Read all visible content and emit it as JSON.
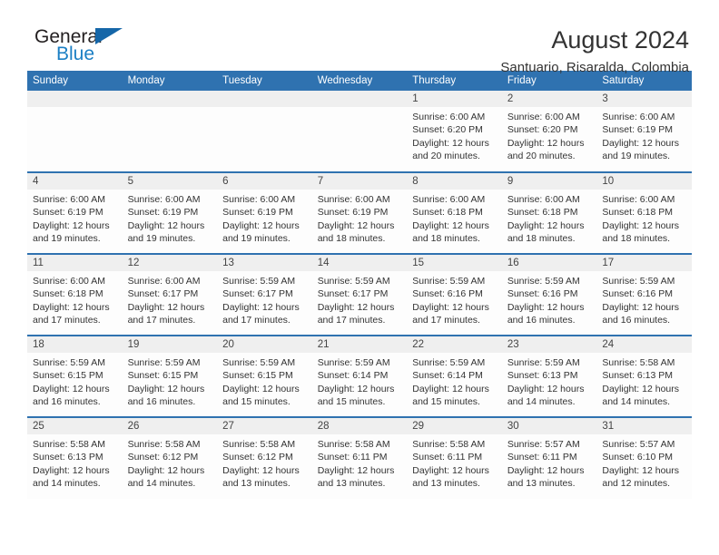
{
  "brand": {
    "name_top": "General",
    "name_bottom": "Blue",
    "mark": "triangle-logo-mark",
    "color_text": "#231f20",
    "color_blue": "#1b7fc4",
    "color_mark": "#1566a8"
  },
  "header": {
    "month_title": "August 2024",
    "location": "Santuario, Risaralda, Colombia"
  },
  "theme": {
    "header_blue": "#2f72b0",
    "daynum_band": "#efefef",
    "text": "#333333"
  },
  "weekday_headers": [
    "Sunday",
    "Monday",
    "Tuesday",
    "Wednesday",
    "Thursday",
    "Friday",
    "Saturday"
  ],
  "weeks": [
    [
      {
        "day": "",
        "empty": true,
        "sunrise": "",
        "sunset": "",
        "daylight_line1": "",
        "daylight_line2": ""
      },
      {
        "day": "",
        "empty": true,
        "sunrise": "",
        "sunset": "",
        "daylight_line1": "",
        "daylight_line2": ""
      },
      {
        "day": "",
        "empty": true,
        "sunrise": "",
        "sunset": "",
        "daylight_line1": "",
        "daylight_line2": ""
      },
      {
        "day": "",
        "empty": true,
        "sunrise": "",
        "sunset": "",
        "daylight_line1": "",
        "daylight_line2": ""
      },
      {
        "day": "1",
        "empty": false,
        "sunrise": "Sunrise: 6:00 AM",
        "sunset": "Sunset: 6:20 PM",
        "daylight_line1": "Daylight: 12 hours",
        "daylight_line2": "and 20 minutes."
      },
      {
        "day": "2",
        "empty": false,
        "sunrise": "Sunrise: 6:00 AM",
        "sunset": "Sunset: 6:20 PM",
        "daylight_line1": "Daylight: 12 hours",
        "daylight_line2": "and 20 minutes."
      },
      {
        "day": "3",
        "empty": false,
        "sunrise": "Sunrise: 6:00 AM",
        "sunset": "Sunset: 6:19 PM",
        "daylight_line1": "Daylight: 12 hours",
        "daylight_line2": "and 19 minutes."
      }
    ],
    [
      {
        "day": "4",
        "empty": false,
        "sunrise": "Sunrise: 6:00 AM",
        "sunset": "Sunset: 6:19 PM",
        "daylight_line1": "Daylight: 12 hours",
        "daylight_line2": "and 19 minutes."
      },
      {
        "day": "5",
        "empty": false,
        "sunrise": "Sunrise: 6:00 AM",
        "sunset": "Sunset: 6:19 PM",
        "daylight_line1": "Daylight: 12 hours",
        "daylight_line2": "and 19 minutes."
      },
      {
        "day": "6",
        "empty": false,
        "sunrise": "Sunrise: 6:00 AM",
        "sunset": "Sunset: 6:19 PM",
        "daylight_line1": "Daylight: 12 hours",
        "daylight_line2": "and 19 minutes."
      },
      {
        "day": "7",
        "empty": false,
        "sunrise": "Sunrise: 6:00 AM",
        "sunset": "Sunset: 6:19 PM",
        "daylight_line1": "Daylight: 12 hours",
        "daylight_line2": "and 18 minutes."
      },
      {
        "day": "8",
        "empty": false,
        "sunrise": "Sunrise: 6:00 AM",
        "sunset": "Sunset: 6:18 PM",
        "daylight_line1": "Daylight: 12 hours",
        "daylight_line2": "and 18 minutes."
      },
      {
        "day": "9",
        "empty": false,
        "sunrise": "Sunrise: 6:00 AM",
        "sunset": "Sunset: 6:18 PM",
        "daylight_line1": "Daylight: 12 hours",
        "daylight_line2": "and 18 minutes."
      },
      {
        "day": "10",
        "empty": false,
        "sunrise": "Sunrise: 6:00 AM",
        "sunset": "Sunset: 6:18 PM",
        "daylight_line1": "Daylight: 12 hours",
        "daylight_line2": "and 18 minutes."
      }
    ],
    [
      {
        "day": "11",
        "empty": false,
        "sunrise": "Sunrise: 6:00 AM",
        "sunset": "Sunset: 6:18 PM",
        "daylight_line1": "Daylight: 12 hours",
        "daylight_line2": "and 17 minutes."
      },
      {
        "day": "12",
        "empty": false,
        "sunrise": "Sunrise: 6:00 AM",
        "sunset": "Sunset: 6:17 PM",
        "daylight_line1": "Daylight: 12 hours",
        "daylight_line2": "and 17 minutes."
      },
      {
        "day": "13",
        "empty": false,
        "sunrise": "Sunrise: 5:59 AM",
        "sunset": "Sunset: 6:17 PM",
        "daylight_line1": "Daylight: 12 hours",
        "daylight_line2": "and 17 minutes."
      },
      {
        "day": "14",
        "empty": false,
        "sunrise": "Sunrise: 5:59 AM",
        "sunset": "Sunset: 6:17 PM",
        "daylight_line1": "Daylight: 12 hours",
        "daylight_line2": "and 17 minutes."
      },
      {
        "day": "15",
        "empty": false,
        "sunrise": "Sunrise: 5:59 AM",
        "sunset": "Sunset: 6:16 PM",
        "daylight_line1": "Daylight: 12 hours",
        "daylight_line2": "and 17 minutes."
      },
      {
        "day": "16",
        "empty": false,
        "sunrise": "Sunrise: 5:59 AM",
        "sunset": "Sunset: 6:16 PM",
        "daylight_line1": "Daylight: 12 hours",
        "daylight_line2": "and 16 minutes."
      },
      {
        "day": "17",
        "empty": false,
        "sunrise": "Sunrise: 5:59 AM",
        "sunset": "Sunset: 6:16 PM",
        "daylight_line1": "Daylight: 12 hours",
        "daylight_line2": "and 16 minutes."
      }
    ],
    [
      {
        "day": "18",
        "empty": false,
        "sunrise": "Sunrise: 5:59 AM",
        "sunset": "Sunset: 6:15 PM",
        "daylight_line1": "Daylight: 12 hours",
        "daylight_line2": "and 16 minutes."
      },
      {
        "day": "19",
        "empty": false,
        "sunrise": "Sunrise: 5:59 AM",
        "sunset": "Sunset: 6:15 PM",
        "daylight_line1": "Daylight: 12 hours",
        "daylight_line2": "and 16 minutes."
      },
      {
        "day": "20",
        "empty": false,
        "sunrise": "Sunrise: 5:59 AM",
        "sunset": "Sunset: 6:15 PM",
        "daylight_line1": "Daylight: 12 hours",
        "daylight_line2": "and 15 minutes."
      },
      {
        "day": "21",
        "empty": false,
        "sunrise": "Sunrise: 5:59 AM",
        "sunset": "Sunset: 6:14 PM",
        "daylight_line1": "Daylight: 12 hours",
        "daylight_line2": "and 15 minutes."
      },
      {
        "day": "22",
        "empty": false,
        "sunrise": "Sunrise: 5:59 AM",
        "sunset": "Sunset: 6:14 PM",
        "daylight_line1": "Daylight: 12 hours",
        "daylight_line2": "and 15 minutes."
      },
      {
        "day": "23",
        "empty": false,
        "sunrise": "Sunrise: 5:59 AM",
        "sunset": "Sunset: 6:13 PM",
        "daylight_line1": "Daylight: 12 hours",
        "daylight_line2": "and 14 minutes."
      },
      {
        "day": "24",
        "empty": false,
        "sunrise": "Sunrise: 5:58 AM",
        "sunset": "Sunset: 6:13 PM",
        "daylight_line1": "Daylight: 12 hours",
        "daylight_line2": "and 14 minutes."
      }
    ],
    [
      {
        "day": "25",
        "empty": false,
        "sunrise": "Sunrise: 5:58 AM",
        "sunset": "Sunset: 6:13 PM",
        "daylight_line1": "Daylight: 12 hours",
        "daylight_line2": "and 14 minutes."
      },
      {
        "day": "26",
        "empty": false,
        "sunrise": "Sunrise: 5:58 AM",
        "sunset": "Sunset: 6:12 PM",
        "daylight_line1": "Daylight: 12 hours",
        "daylight_line2": "and 14 minutes."
      },
      {
        "day": "27",
        "empty": false,
        "sunrise": "Sunrise: 5:58 AM",
        "sunset": "Sunset: 6:12 PM",
        "daylight_line1": "Daylight: 12 hours",
        "daylight_line2": "and 13 minutes."
      },
      {
        "day": "28",
        "empty": false,
        "sunrise": "Sunrise: 5:58 AM",
        "sunset": "Sunset: 6:11 PM",
        "daylight_line1": "Daylight: 12 hours",
        "daylight_line2": "and 13 minutes."
      },
      {
        "day": "29",
        "empty": false,
        "sunrise": "Sunrise: 5:58 AM",
        "sunset": "Sunset: 6:11 PM",
        "daylight_line1": "Daylight: 12 hours",
        "daylight_line2": "and 13 minutes."
      },
      {
        "day": "30",
        "empty": false,
        "sunrise": "Sunrise: 5:57 AM",
        "sunset": "Sunset: 6:11 PM",
        "daylight_line1": "Daylight: 12 hours",
        "daylight_line2": "and 13 minutes."
      },
      {
        "day": "31",
        "empty": false,
        "sunrise": "Sunrise: 5:57 AM",
        "sunset": "Sunset: 6:10 PM",
        "daylight_line1": "Daylight: 12 hours",
        "daylight_line2": "and 12 minutes."
      }
    ]
  ]
}
